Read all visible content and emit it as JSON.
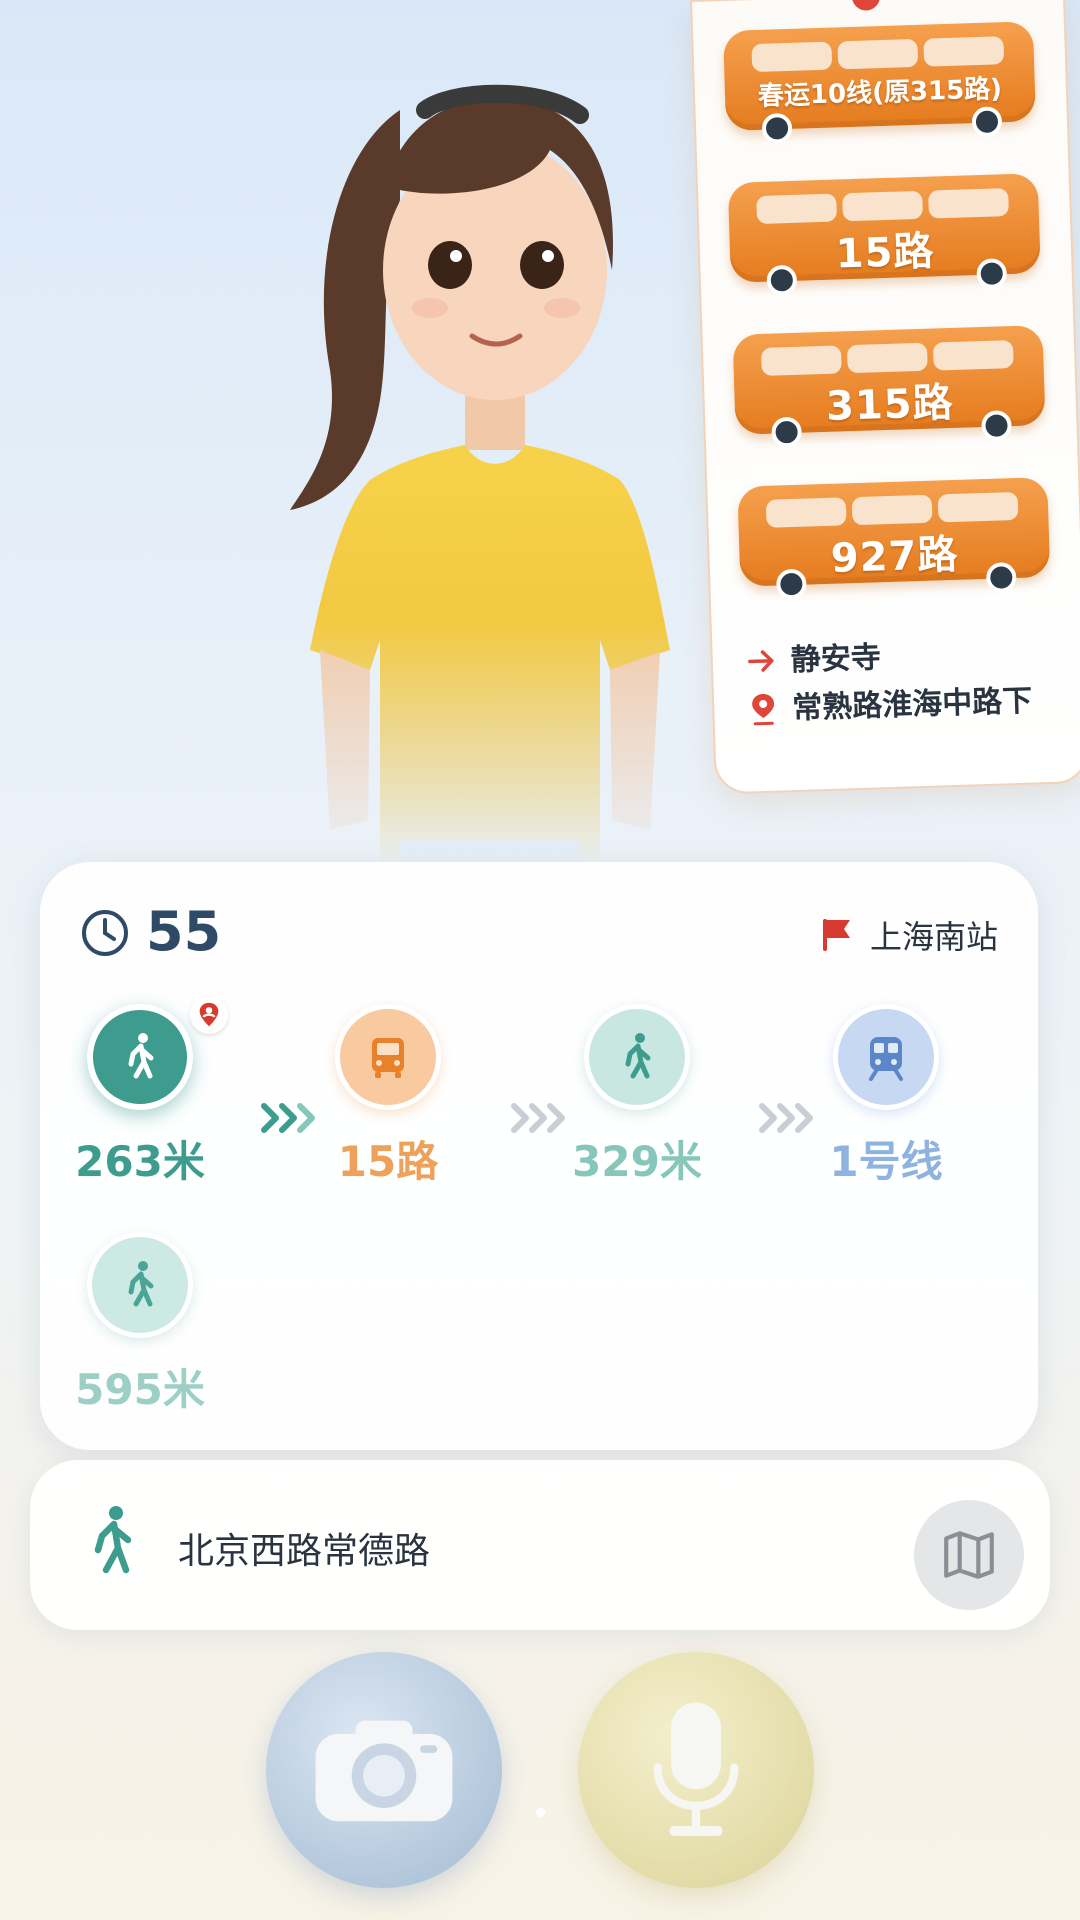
{
  "bus_panel": {
    "routes": [
      {
        "label": "春运10线(原315路)"
      },
      {
        "label": "15路"
      },
      {
        "label": "315路"
      },
      {
        "label": "927路"
      }
    ],
    "direction": "静安寺",
    "stop": "常熟路淮海中路下"
  },
  "route": {
    "duration": "55",
    "destination": "上海南站",
    "steps": [
      {
        "type": "walk",
        "value": "263米",
        "color": "#3e9c8e"
      },
      {
        "type": "bus",
        "value": "15路",
        "color": "#eea15a"
      },
      {
        "type": "walk",
        "value": "329米",
        "color": "#86c6bb"
      },
      {
        "type": "metro",
        "value": "1号线",
        "color": "#8fb3e0"
      },
      {
        "type": "walk",
        "value": "595米",
        "color": "#9ccfc5"
      }
    ]
  },
  "address_bar": {
    "text": "北京西路常德路"
  },
  "icons": {
    "clock": "clock-icon",
    "flag": "flag-icon",
    "map": "map-icon",
    "camera": "camera-icon",
    "microphone": "microphone-icon"
  }
}
